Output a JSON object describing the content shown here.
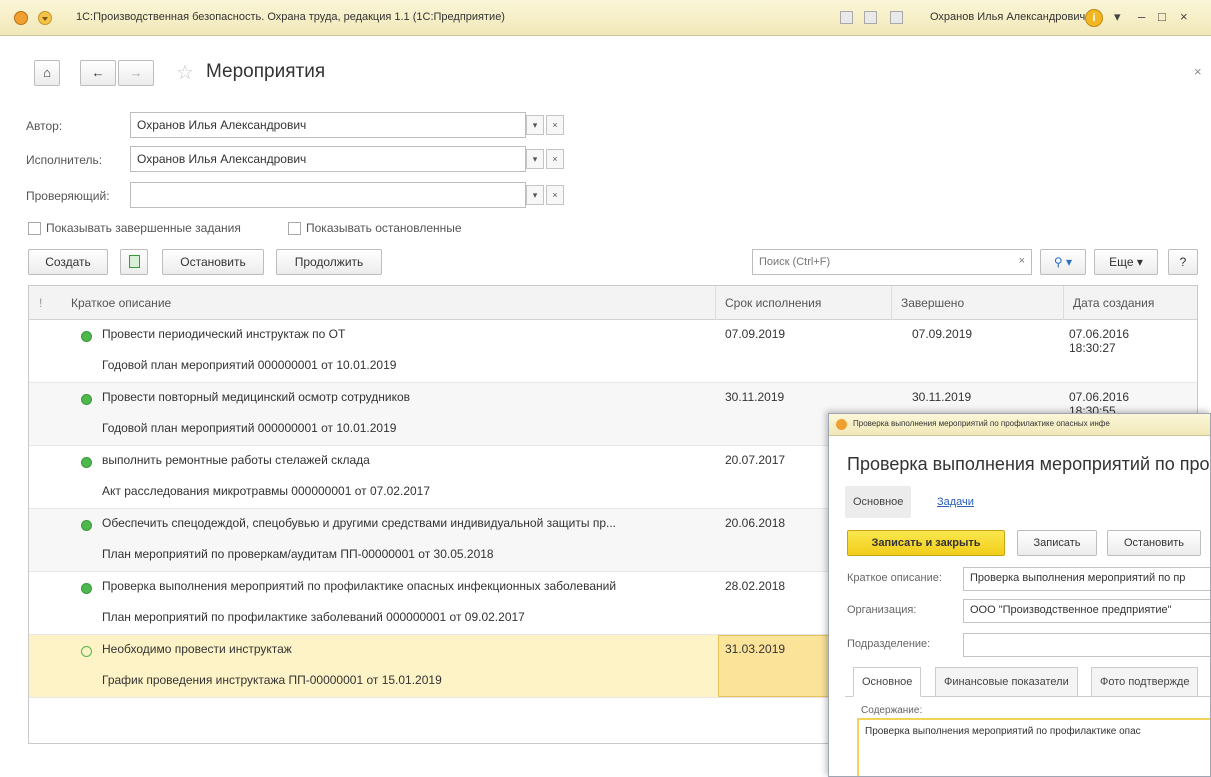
{
  "window": {
    "title": "1С:Производственная безопасность. Охрана труда, редакция 1.1  (1С:Предприятие)",
    "user": "Охранов Илья Александрович"
  },
  "header": {
    "title": "Мероприятия"
  },
  "filters": {
    "author_label": "Автор:",
    "author_value": "Охранов Илья Александрович",
    "executor_label": "Исполнитель:",
    "executor_value": "Охранов Илья Александрович",
    "reviewer_label": "Проверяющий:",
    "reviewer_value": "",
    "show_completed": "Показывать завершенные задания",
    "show_stopped": "Показывать остановленные"
  },
  "toolbar": {
    "create": "Создать",
    "stop": "Остановить",
    "continue": "Продолжить",
    "search_placeholder": "Поиск (Ctrl+F)",
    "more": "Еще",
    "help": "?"
  },
  "table": {
    "columns": {
      "flag": "!",
      "description": "Краткое описание",
      "due": "Срок исполнения",
      "completed": "Завершено",
      "created": "Дата создания"
    },
    "rows": [
      {
        "description": "Провести периодический инструктаж по ОТ",
        "basis": "Годовой план мероприятий 000000001 от 10.01.2019",
        "due": "07.09.2019",
        "completed": "07.09.2019",
        "created": "07.06.2016 18:30:27"
      },
      {
        "description": "Провести повторный медицинский осмотр сотрудников",
        "basis": "Годовой план мероприятий 000000001 от 10.01.2019",
        "due": "30.11.2019",
        "completed": "30.11.2019",
        "created": "07.06.2016 18:30:55"
      },
      {
        "description": "выполнить ремонтные работы стелажей склада",
        "basis": "Акт расследования микротравмы 000000001 от 07.02.2017",
        "due": "20.07.2017",
        "completed": "",
        "created": ""
      },
      {
        "description": "Обеспечить спецодеждой, спецобувью и другими средствами индивидуальной защиты пр...",
        "basis": "План мероприятий по проверкам/аудитам ПП-00000001 от 30.05.2018",
        "due": "20.06.2018",
        "completed": "",
        "created": ""
      },
      {
        "description": "Проверка выполнения мероприятий по профилактике опасных инфекционных заболеваний",
        "basis": "План мероприятий по профилактике заболеваний 000000001 от 09.02.2017",
        "due": "28.02.2018",
        "completed": "",
        "created": ""
      },
      {
        "description": "Необходимо провести инструктаж",
        "basis": "График проведения инструктажа ПП-00000001 от 15.01.2019",
        "due": "31.03.2019",
        "completed": "",
        "created": ""
      }
    ]
  },
  "popup": {
    "window_title": "Проверка выполнения мероприятий по профилактике опасных инфе",
    "title": "Проверка выполнения мероприятий по про",
    "tab_main": "Основное",
    "tab_tasks": "Задачи",
    "btn_save_close": "Записать и закрыть",
    "btn_save": "Записать",
    "btn_stop": "Остановить",
    "short_desc_label": "Краткое описание:",
    "short_desc_value": "Проверка выполнения мероприятий по пр",
    "org_label": "Организация:",
    "org_value": "ООО \"Производственное предприятие\"",
    "dept_label": "Подразделение:",
    "dept_value": "",
    "subtab_main": "Основное",
    "subtab_fin": "Финансовые показатели",
    "subtab_photo": "Фото подтвержде",
    "content_label": "Содержание:",
    "content_value": "Проверка выполнения мероприятий по профилактике опас"
  },
  "colors": {
    "accent_yellow": "#f1cd1a",
    "status_green": "#4db84d",
    "selection": "#fdf3c7"
  }
}
